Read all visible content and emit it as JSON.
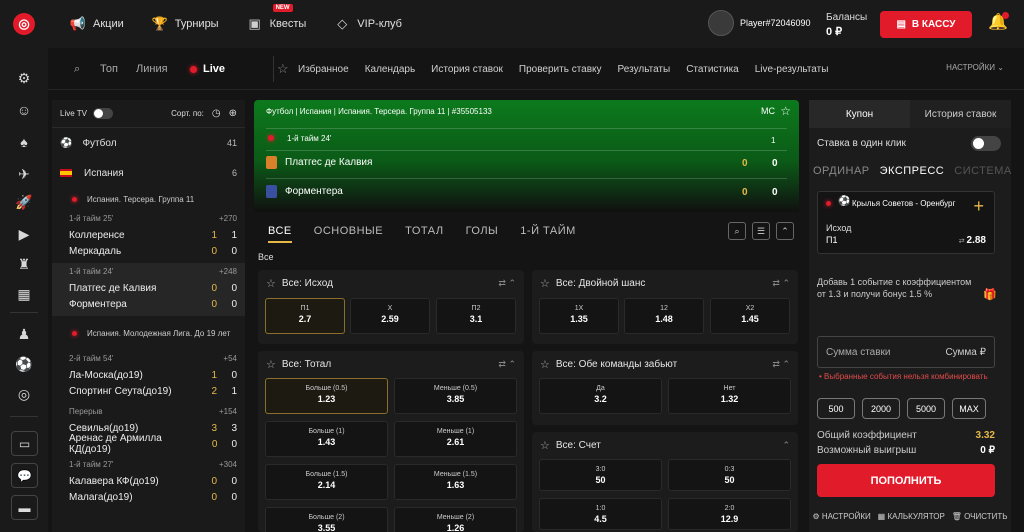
{
  "top": {
    "nav": [
      {
        "label": "Акции",
        "icon": "megaphone-icon"
      },
      {
        "label": "Турниры",
        "icon": "trophy-icon"
      },
      {
        "label": "Квесты",
        "icon": "quest-icon",
        "badge": "NEW"
      },
      {
        "label": "VIP-клуб",
        "icon": "diamond-icon"
      }
    ],
    "player": "Player#72046090",
    "balance_label": "Балансы",
    "balance_value": "0 ₽",
    "cash_button": "В КАССУ",
    "accent": "#e21b2b"
  },
  "subbar": {
    "top": "Топ",
    "line": "Линия",
    "live": "Live",
    "links": [
      "Избранное",
      "Календарь",
      "История ставок",
      "Проверить ставку",
      "Результаты",
      "Статистика",
      "Live-результаты"
    ],
    "settings": "НАСТРОЙКИ"
  },
  "left": {
    "live_tv": "Live TV",
    "sort": "Сорт. по:",
    "sport": "Футбол",
    "sport_count": "41",
    "country": "Испания",
    "country_count": "6",
    "league1": "Испания. Терсера. Группа 11",
    "league2": "Испания. Молодежная Лига. До 19 лет",
    "matches": [
      {
        "period": "1-й тайм 25'",
        "plus": "+270",
        "t1": "Коллеренсе",
        "t2": "Меркадаль",
        "a1": "1",
        "a2": "0",
        "b1": "1",
        "b2": "0"
      },
      {
        "period": "1-й тайм 24'",
        "plus": "+248",
        "t1": "Платгес де Калвия",
        "t2": "Форментера",
        "a1": "0",
        "a2": "0",
        "b1": "0",
        "b2": "0"
      },
      {
        "period": "2-й тайм 54'",
        "plus": "+54",
        "t1": "Ла-Моска(до19)",
        "t2": "Спортинг Сеута(до19)",
        "a1": "1",
        "a2": "2",
        "b1": "0",
        "b2": "1"
      },
      {
        "period": "Перерыв",
        "plus": "+154",
        "t1": "Севилья(до19)",
        "t2": "Аренас де Армилла КД(до19)",
        "a1": "3",
        "a2": "0",
        "b1": "3",
        "b2": "0"
      },
      {
        "period": "1-й тайм 27'",
        "plus": "+304",
        "t1": "Калавера КФ(до19)",
        "t2": "Малага(до19)",
        "a1": "0",
        "a2": "0",
        "b1": "0",
        "b2": "0"
      }
    ]
  },
  "hero": {
    "crumb": "Футбол | Испания | Испания. Терсера. Группа 11 | #35505133",
    "mc": "MC",
    "period": "1-й тайм 24'",
    "col": "1",
    "team1": "Платгес де Калвия",
    "team2": "Форментера",
    "s1a": "0",
    "s1b": "0",
    "s2a": "0",
    "s2b": "0"
  },
  "tabs": [
    "ВСЕ",
    "ОСНОВНЫЕ",
    "ТОТАЛ",
    "ГОЛЫ",
    "1-Й ТАЙМ"
  ],
  "vse": "Все",
  "markets": {
    "ishod": {
      "title": "Все: Исход",
      "odds": [
        {
          "n": "П1",
          "v": "2.7"
        },
        {
          "n": "Х",
          "v": "2.59"
        },
        {
          "n": "П2",
          "v": "3.1"
        }
      ]
    },
    "dvoynoy": {
      "title": "Все: Двойной шанс",
      "odds": [
        {
          "n": "1X",
          "v": "1.35"
        },
        {
          "n": "12",
          "v": "1.48"
        },
        {
          "n": "X2",
          "v": "1.45"
        }
      ]
    },
    "total": {
      "title": "Все: Тотал",
      "odds": [
        {
          "n": "Больше (0.5)",
          "v": "1.23"
        },
        {
          "n": "Меньше (0.5)",
          "v": "3.85"
        },
        {
          "n": "Больше (1)",
          "v": "1.43"
        },
        {
          "n": "Меньше (1)",
          "v": "2.61"
        },
        {
          "n": "Больше (1.5)",
          "v": "2.14"
        },
        {
          "n": "Меньше (1.5)",
          "v": "1.63"
        },
        {
          "n": "Больше (2)",
          "v": "3.55"
        },
        {
          "n": "Меньше (2)",
          "v": "1.26"
        }
      ]
    },
    "obe": {
      "title": "Все: Обе команды забьют",
      "odds": [
        {
          "n": "Да",
          "v": "3.2"
        },
        {
          "n": "Нет",
          "v": "1.32"
        }
      ]
    },
    "schet": {
      "title": "Все: Счет",
      "odds": [
        {
          "n": "3:0",
          "v": "50"
        },
        {
          "n": "0:3",
          "v": "50"
        },
        {
          "n": "1:0",
          "v": "4.5"
        },
        {
          "n": "2:0",
          "v": "12.9"
        }
      ]
    }
  },
  "coupon": {
    "tab1": "Купон",
    "tab2": "История ставок",
    "oneclick": "Ставка в один клик",
    "types": [
      "ОРДИНАР",
      "ЭКСПРЕСС",
      "СИСТЕМА"
    ],
    "event": "Крылья Советов - Оренбург",
    "market": "Исход",
    "pick": "П1",
    "odd": "2.88",
    "promo": "Добавь 1 событие с коэффициентом от 1.3 и получи бонус 1.5 %",
    "stake_placeholder": "Сумма ставки",
    "stake_right": "Сумма ₽",
    "warning": "Выбранные события нельзя комбинировать",
    "amounts": [
      "500",
      "2000",
      "5000",
      "MAX"
    ],
    "total_label": "Общий коэффициент",
    "total_value": "3.32",
    "win_label": "Возможный выигрыш",
    "win_value": "0 ₽",
    "fill": "ПОПОЛНИТЬ",
    "footer": [
      "НАСТРОЙКИ",
      "КАЛЬКУЛЯТОР",
      "ОЧИСТИТЬ"
    ]
  }
}
